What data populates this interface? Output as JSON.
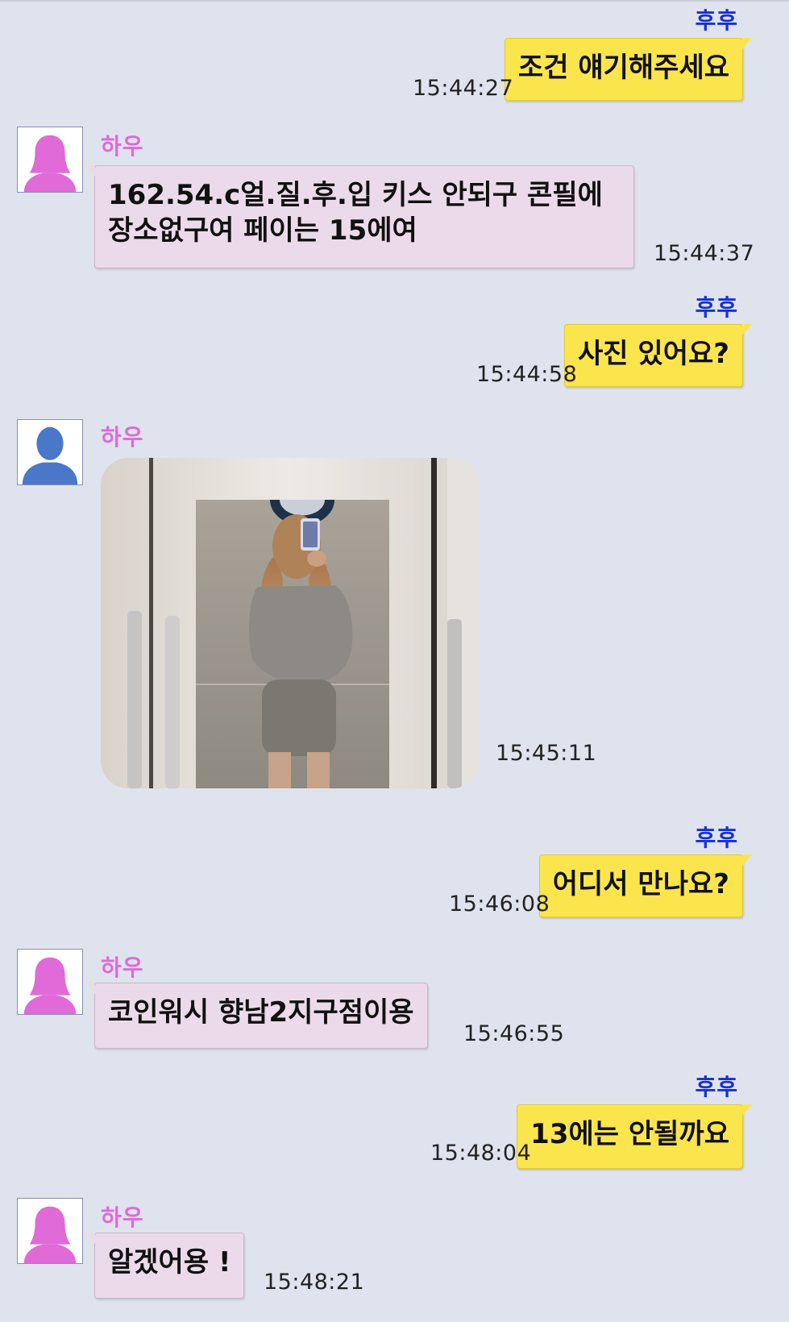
{
  "chat": {
    "me_name": "후후",
    "other_name": "하우",
    "messages": [
      {
        "text": "조건 얘기해주세요",
        "time": "15:44:27"
      },
      {
        "text_line1": "162.54.c얼.질.후.입 키스 안되구 콘필에",
        "text_line2": "장소없구여 페이는 15에여",
        "time": "15:44:37"
      },
      {
        "text": "사진 있어요?",
        "time": "15:44:58"
      },
      {
        "time": "15:45:11"
      },
      {
        "text": "어디서 만나요?",
        "time": "15:46:08"
      },
      {
        "text": "코인워시 향남2지구점이용",
        "time": "15:46:55"
      },
      {
        "text": "13에는 안될까요",
        "time": "15:48:04"
      },
      {
        "text": "알겠어용 !",
        "time": "15:48:21"
      }
    ]
  },
  "colors": {
    "background": "#dfe3ee",
    "my_bubble": "#fbe54c",
    "their_bubble": "#ebdbea",
    "my_name": "#1630d8",
    "their_name": "#e06ad8",
    "avatar_female": "#e06ad8",
    "avatar_generic": "#4a78c9"
  },
  "icons": {
    "female_avatar": "female-silhouette-icon",
    "generic_avatar": "person-silhouette-icon"
  }
}
